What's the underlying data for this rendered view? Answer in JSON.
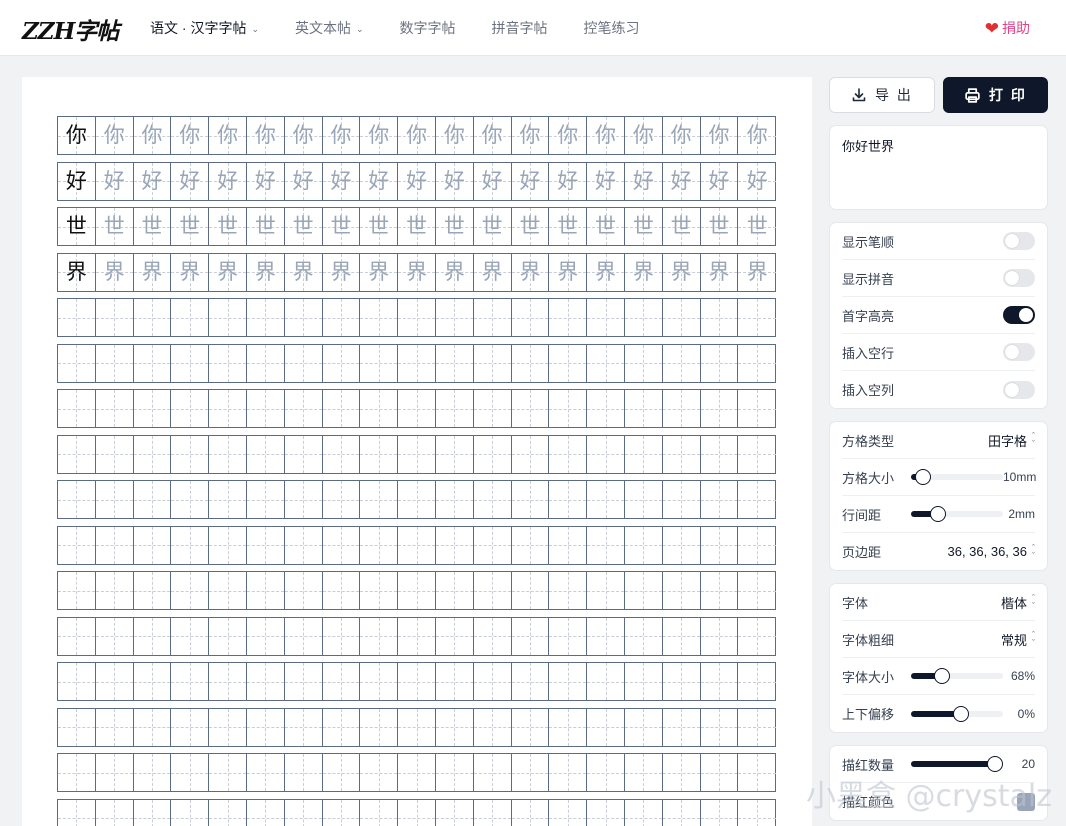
{
  "header": {
    "logo": "ZZH字帖",
    "nav": [
      {
        "label": "语文 · 汉字字帖",
        "dropdown": true,
        "active": true
      },
      {
        "label": "英文本帖",
        "dropdown": true,
        "active": false
      },
      {
        "label": "数字字帖",
        "dropdown": false,
        "active": false
      },
      {
        "label": "拼音字帖",
        "dropdown": false,
        "active": false
      },
      {
        "label": "控笔练习",
        "dropdown": false,
        "active": false
      }
    ],
    "donate": "捐助",
    "donate_icon": "heart-icon"
  },
  "worksheet": {
    "characters": [
      "你",
      "好",
      "世",
      "界"
    ],
    "cells_per_row": 19,
    "total_rows": 16,
    "trace_color": "#9aa6b8",
    "grid_color": "#5b6b84"
  },
  "actions": {
    "export": "导 出",
    "print": "打 印"
  },
  "text_input": {
    "value": "你好世界"
  },
  "toggles": [
    {
      "label": "显示笔顺",
      "on": false
    },
    {
      "label": "显示拼音",
      "on": false
    },
    {
      "label": "首字高亮",
      "on": true
    },
    {
      "label": "插入空行",
      "on": false
    },
    {
      "label": "插入空列",
      "on": false
    }
  ],
  "grid_settings": {
    "type_label": "方格类型",
    "type_value": "田字格",
    "size_label": "方格大小",
    "size_value": "10mm",
    "size_fraction": 0.05,
    "line_gap_label": "行间距",
    "line_gap_value": "2mm",
    "line_gap_fraction": 0.25,
    "margin_label": "页边距",
    "margin_value": "36, 36, 36, 36"
  },
  "font_settings": {
    "font_label": "字体",
    "font_value": "楷体",
    "weight_label": "字体粗细",
    "weight_value": "常规",
    "size_label": "字体大小",
    "size_value": "68%",
    "size_fraction": 0.3,
    "offset_label": "上下偏移",
    "offset_value": "0%",
    "offset_fraction": 0.55
  },
  "trace_settings": {
    "count_label": "描红数量",
    "count_value": "20",
    "count_fraction": 1.0,
    "color_label": "描红颜色",
    "color_value": "#98a4b8"
  },
  "watermark": "小黑盒 @crystalz"
}
